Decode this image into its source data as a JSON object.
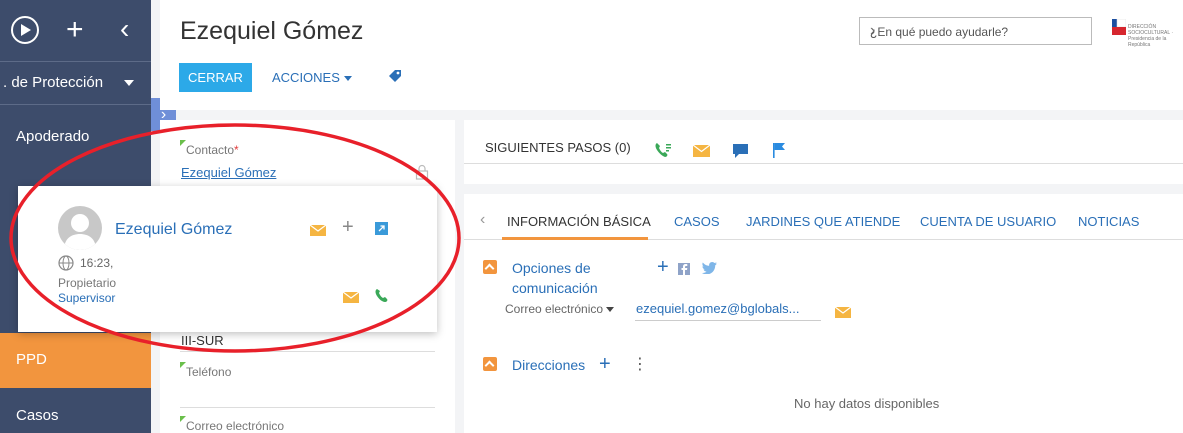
{
  "nav": {
    "section_label": ". de Protección",
    "items": [
      {
        "label": "Apoderado"
      },
      {
        "label": "PPD"
      },
      {
        "label": "Casos"
      }
    ]
  },
  "header": {
    "title": "Ezequiel Gómez",
    "close_label": "CERRAR",
    "actions_label": "ACCIONES",
    "help_placeholder": "¿En qué puedo ayudarle?",
    "logo_text": "DIRECCIÓN SOCIOCULTURAL · Presidencia de la República"
  },
  "left_panel": {
    "contact_label": "Contacto",
    "required_mark": "*",
    "contact_value": "Ezequiel Gómez",
    "region_value": "III-SUR",
    "phone_label": "Teléfono",
    "email_label": "Correo electrónico"
  },
  "popup": {
    "name": "Ezequiel Gómez",
    "time": "16:23,",
    "role_label": "Propietario",
    "role_value": "Supervisor"
  },
  "steps": {
    "title": "SIGUIENTES PASOS (0)"
  },
  "tabs": [
    {
      "label": "INFORMACIÓN BÁSICA",
      "active": true
    },
    {
      "label": "CASOS"
    },
    {
      "label": "JARDINES QUE ATIENDE"
    },
    {
      "label": "CUENTA DE USUARIO"
    },
    {
      "label": "NOTICIAS"
    }
  ],
  "comms": {
    "title_line1": "Opciones de",
    "title_line2": "comunicación",
    "email_type": "Correo electrónico",
    "email_value": "ezequiel.gomez@bglobals..."
  },
  "addresses": {
    "title": "Direcciones",
    "empty_text": "No hay datos disponibles"
  },
  "colors": {
    "nav_bg": "#3d4c6b",
    "accent_orange": "#f2953e",
    "primary_blue": "#2ca9e8",
    "link_blue": "#2a6fb7",
    "annotation_red": "#e8202a"
  }
}
